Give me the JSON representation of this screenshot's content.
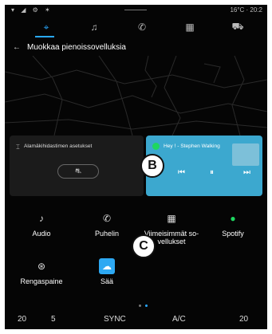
{
  "status": {
    "left_icons": "▾ ◢ ⚙ ✶",
    "temp_time": "16°C · 20:2"
  },
  "nav": {
    "items": [
      {
        "name": "nav-location-icon",
        "glyph": "⌖",
        "active": true
      },
      {
        "name": "nav-music-icon",
        "glyph": "♫",
        "active": false
      },
      {
        "name": "nav-phone-icon",
        "glyph": "✆",
        "active": false
      },
      {
        "name": "nav-apps-icon",
        "glyph": "▦",
        "active": false
      },
      {
        "name": "nav-car-icon",
        "glyph": "⛟",
        "active": false
      }
    ]
  },
  "header": {
    "back_icon": "←",
    "title": "Muokkaa pienoissovelluksia"
  },
  "widgets": {
    "left": {
      "icon": "⌶",
      "title": "Alamäkihidastimen asetukset",
      "button_icon": "⛐"
    },
    "right": {
      "title": "Hey ! - Stephen Walking",
      "prev": "⏮",
      "pause": "⏸",
      "next": "⏭"
    }
  },
  "badges": {
    "b": "B",
    "c": "C"
  },
  "apps": [
    {
      "label": "Audio",
      "icon": "♪"
    },
    {
      "label": "Puhelin",
      "icon": "✆"
    },
    {
      "label": "Viimeisimmät so-\nvellukset",
      "icon": "▦"
    },
    {
      "label": "Spotify",
      "icon": "●"
    },
    {
      "label": "Rengaspaine",
      "icon": "⊛"
    },
    {
      "label": "Sää",
      "icon": "☁"
    }
  ],
  "bottombar": {
    "left_temp": "20",
    "left_fan": "5",
    "sync": "SYNC",
    "ac": "A/C",
    "right_temp": "20"
  }
}
